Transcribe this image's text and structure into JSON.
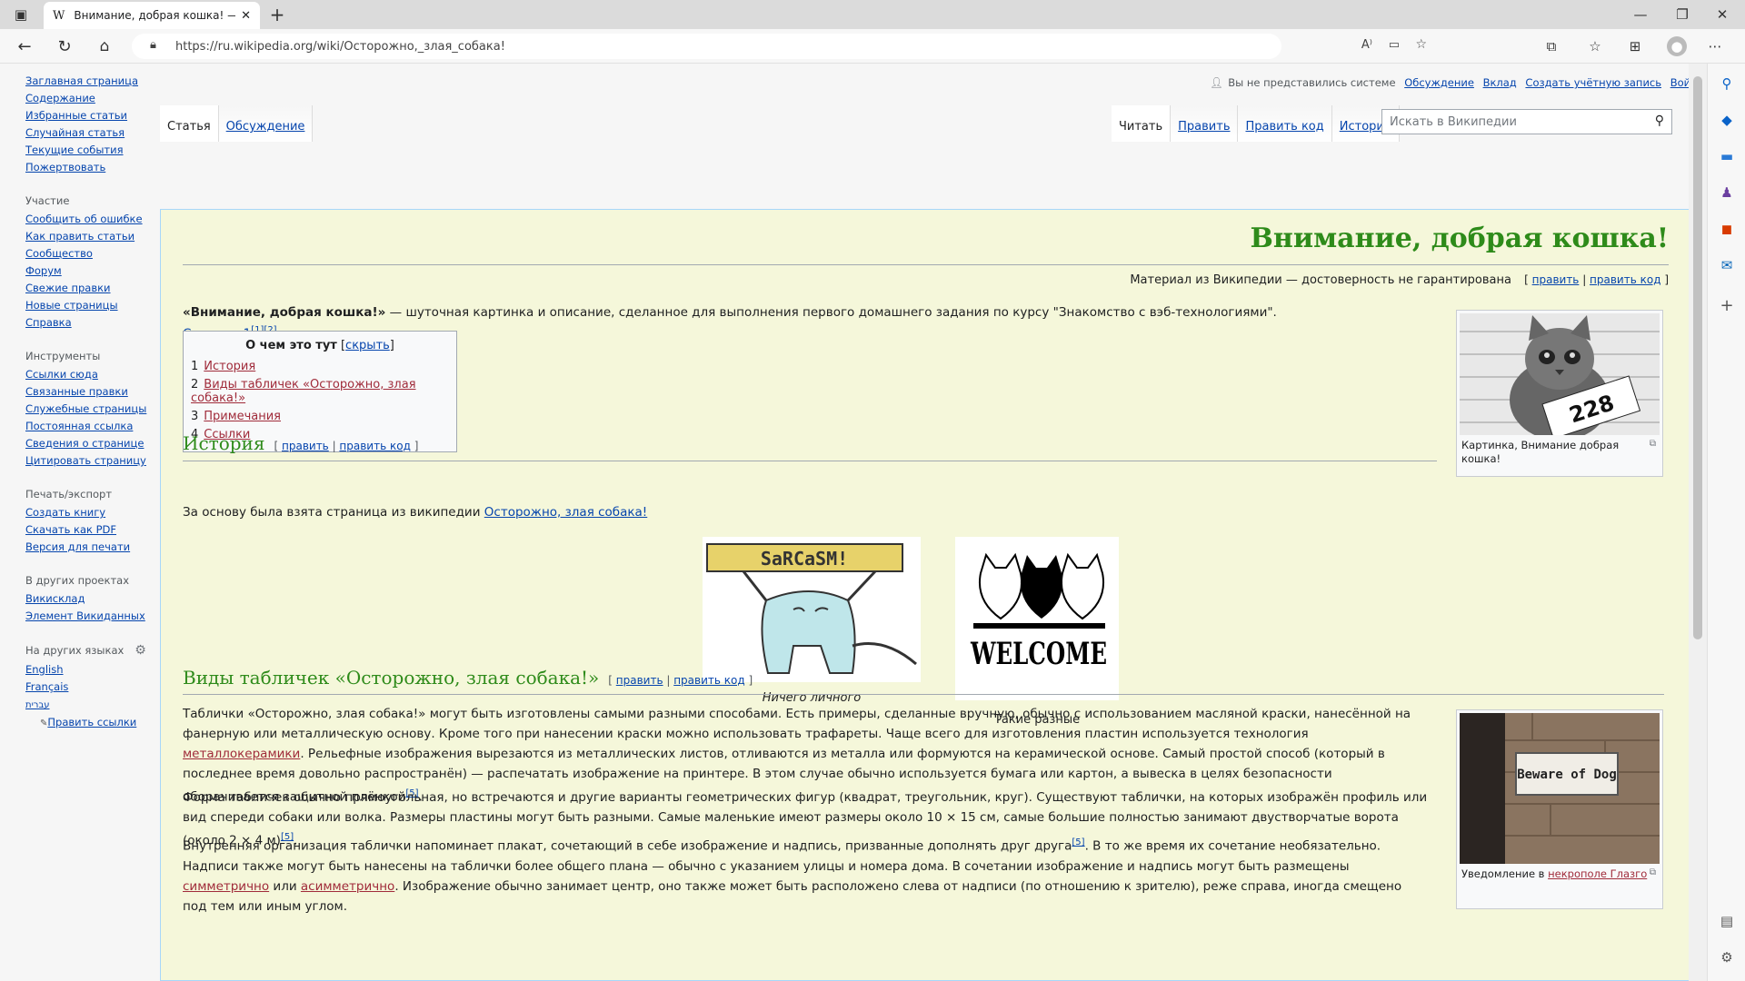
{
  "browser": {
    "tab_title": "Внимание, добрая кошка! — Ви",
    "tab_favicon": "W",
    "url": "https://ru.wikipedia.org/wiki/Осторожно,_злая_собака!"
  },
  "sidebar": {
    "nav": [
      "Заглавная страница",
      "Содержание",
      "Избранные статьи",
      "Случайная статья",
      "Текущие события",
      "Пожертвовать"
    ],
    "participation_title": "Участие",
    "participation": [
      "Сообщить об ошибке",
      "Как править статьи",
      "Сообщество",
      "Форум",
      "Свежие правки",
      "Новые страницы",
      "Справка"
    ],
    "tools_title": "Инструменты",
    "tools": [
      "Ссылки сюда",
      "Связанные правки",
      "Служебные страницы",
      "Постоянная ссылка",
      "Сведения о странице",
      "Цитировать страницу"
    ],
    "print_title": "Печать/экспорт",
    "print": [
      "Создать книгу",
      "Скачать как PDF",
      "Версия для печати"
    ],
    "projects_title": "В других проектах",
    "projects": [
      "Викисклад",
      "Элемент Викиданных"
    ],
    "langs_title": "На других языках",
    "langs": [
      "English",
      "Français",
      "עברית"
    ],
    "edit_links": "Править ссылки"
  },
  "userbar": {
    "status": "Вы не представились системе",
    "links": [
      "Обсуждение",
      "Вклад",
      "Создать учётную запись",
      "Войти"
    ]
  },
  "tabs_left": [
    "Статья",
    "Обсуждение"
  ],
  "tabs_right": [
    "Читать",
    "Править",
    "Править код",
    "История"
  ],
  "search_placeholder": "Искать в Википедии",
  "article": {
    "title": "Внимание, добрая кошка!",
    "tagline": "Материал из Википедии — достоверность не гарантирована",
    "edit": "править",
    "edit_code": "править код",
    "intro_bold": "«Внимание, добрая кошка!»",
    "intro_text": " — шуточная картинка и описание, сделанное для выполнения первого домашнего задания по курсу \"Знакомство с вэб-технологиями\". ",
    "intro_link": "Семинар 1",
    "intro_refs": "[1][2]",
    "toc_title": "О чем это тут",
    "toc_hide": "скрыть",
    "toc": [
      {
        "n": "1",
        "label": "История"
      },
      {
        "n": "2",
        "label": "Виды табличек «Осторожно, злая собака!»"
      },
      {
        "n": "3",
        "label": "Примечания"
      },
      {
        "n": "4",
        "label": "Ссылки"
      }
    ],
    "thumb1_caption": "Картинка, Внимание добрая кошка!",
    "thumb1_number": "228",
    "history_title": "История",
    "history_text": "За основу была взята страница из википедии ",
    "history_link": "Осторожно, злая собака!",
    "gallery1_caption": "Ничего личного",
    "gallery1_sign": "SaRCaSM!",
    "gallery2_caption": "Такие разные",
    "gallery2_sign": "WELCOME",
    "types_title": "Виды табличек «Осторожно, злая собака!»",
    "p1a": "Таблички «Осторожно, злая собака!» могут быть изготовлены самыми разными способами. Есть примеры, сделанные вручную, обычно с использованием масляной краски, нанесённой на фанерную или металлическую основу. Кроме того при нанесении краски можно использовать трафареты. Чаще всего для изготовления пластин используется технология ",
    "p1link": "металлокерамики",
    "p1b": ". Рельефные изображения вырезаются из металлических листов, отливаются из металла или формуются на керамической основе. Самый простой способ (который в последнее время довольно распространён) — распечатать изображение на принтере. В этом случае обычно используется бумага или картон, а вывеска в целях безопасности оборачивается защитной плёнкой",
    "p1ref": "[5]",
    "p2": "Форма табличек обычно прямоугольная, но встречаются и другие варианты геометрических фигур (квадрат, треугольник, круг). Существуют таблички, на которых изображён профиль или вид спереди собаки или волка. Размеры пластины могут быть разными. Самые маленькие имеют размеры около 10 × 15 см, самые большие полностью занимают двустворчатые ворота (около 2 × 4 м)",
    "p2ref": "[5]",
    "p3a": "Внутренняя организация таблички напоминает плакат, сочетающий в себе изображение и надпись, призванные дополнять друг друга",
    "p3ref": "[5]",
    "p3b": ". В то же время их сочетание необязательно. Надписи также могут быть нанесены на таблички более общего плана — обычно с указанием улицы и номера дома. В сочетании изображение и надпись могут быть размещены ",
    "p3link1": "симметрично",
    "p3or": " или ",
    "p3link2": "асимметрично",
    "p3c": ". Изображение обычно занимает центр, оно также может быть расположено слева от надписи (по отношению к зрителю), реже справа, иногда смещено под тем или иным углом.",
    "thumb2_sign": "Beware of Dog",
    "thumb2_caption_a": "Уведомление в ",
    "thumb2_caption_link": "некрополе",
    "thumb2_caption_b": " Глазго"
  }
}
